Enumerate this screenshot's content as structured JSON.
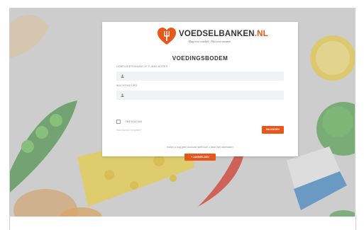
{
  "brand": {
    "name_main": "VOEDSELBANKEN",
    "name_suffix": ".NL",
    "tagline": "Dag voor voedsel · Niet voor mensen",
    "logo_icon": "heart-fork-icon"
  },
  "login": {
    "title": "VOEDINGSBODEM",
    "username_label": "GEBRUIKERSNAAM OF E-MAILADRES",
    "username_icon": "user-icon",
    "username_value": "",
    "password_label": "WACHTWOORD",
    "password_icon": "user-icon",
    "password_value": "",
    "remember_label": "ONTHOUD MIJ",
    "forgot_label": "Wachtwoord vergeten?",
    "submit_label": "INLOGGEN",
    "info_text": "Indien u nog geen account heeft kunt u deze hier aanmaken",
    "register_label": "+ AANMELDEN"
  },
  "colors": {
    "accent": "#e8561c",
    "input_bg": "#f1f2f4",
    "background_overlay": "#dcdcdc"
  }
}
